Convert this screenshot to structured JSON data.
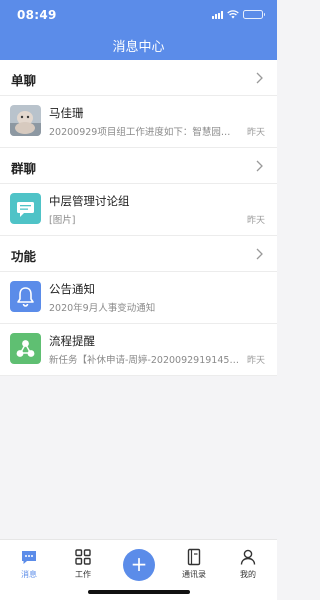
{
  "status_bar": {
    "time": "08:49"
  },
  "header": {
    "title": "消息中心"
  },
  "sections": [
    {
      "label": "单聊"
    },
    {
      "label": "群聊"
    },
    {
      "label": "功能"
    }
  ],
  "items": [
    {
      "name": "马佳珊",
      "subtitle": "20200929项目组工作进度如下：智慧园区...",
      "time": "昨天",
      "icon": "photo-avatar"
    },
    {
      "name": "中层管理讨论组",
      "subtitle": "[图片]",
      "time": "昨天",
      "icon": "group-chat-icon"
    },
    {
      "name": "公告通知",
      "subtitle": "2020年9月人事变动通知",
      "time": "",
      "icon": "bell-icon"
    },
    {
      "name": "流程提醒",
      "subtitle": "新任务【补休申请-周婷-20200929191456...",
      "time": "昨天",
      "icon": "workflow-icon"
    }
  ],
  "tabbar": {
    "tabs": [
      {
        "label": "消息",
        "icon": "message-icon",
        "active": true
      },
      {
        "label": "工作",
        "icon": "grid-icon",
        "active": false
      },
      {
        "label": "通讯录",
        "icon": "contacts-icon",
        "active": false
      },
      {
        "label": "我的",
        "icon": "user-icon",
        "active": false
      }
    ],
    "fab_symbol": "+"
  },
  "colors": {
    "primary": "#5b8ce9",
    "group_icon": "#4fc3c7",
    "bell_icon": "#5b8ce9",
    "workflow_icon": "#5fbf72"
  }
}
